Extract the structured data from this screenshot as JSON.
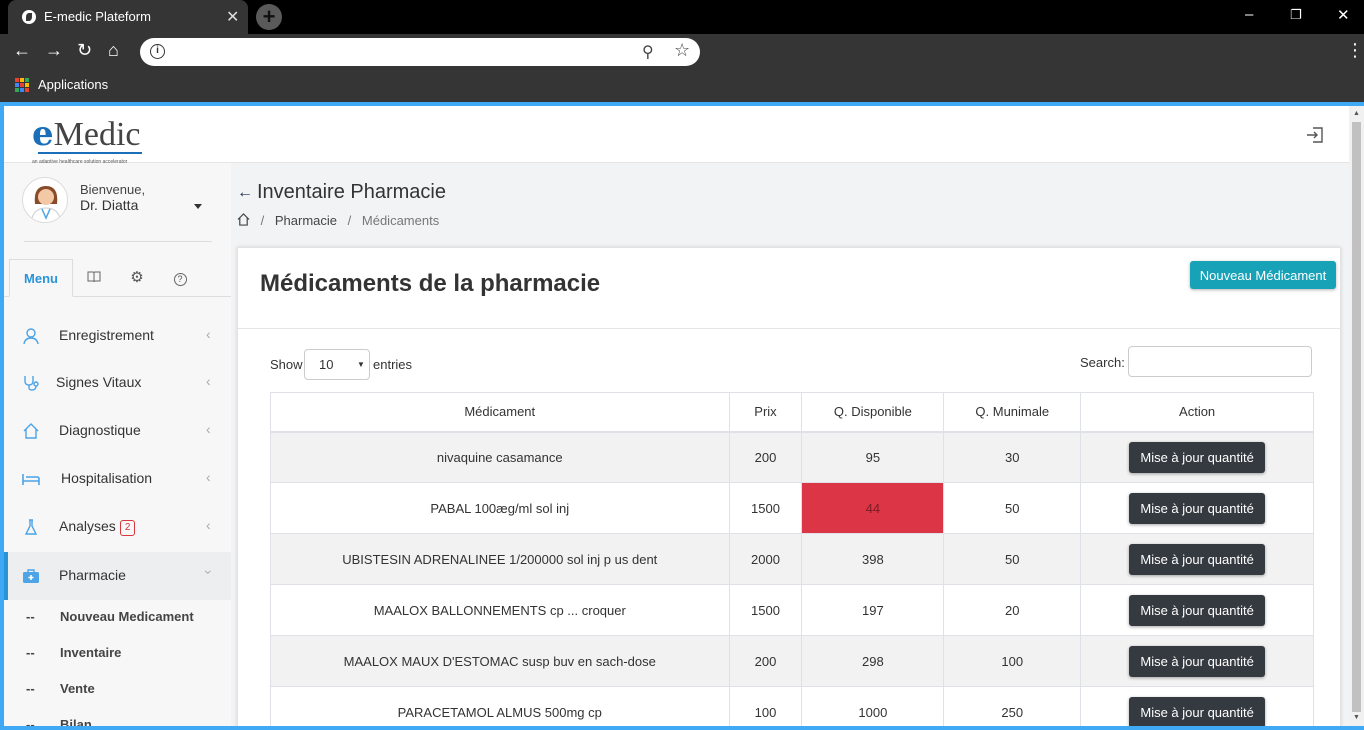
{
  "browser": {
    "tab_title": "E-medic Plateform",
    "tab_close": "✕",
    "new_tab": "+",
    "bookmark_apps": "Applications",
    "url": ""
  },
  "app": {
    "logo_e": "e",
    "logo_medic": "Medic",
    "logo_tagline": "an adaptive healthcare solution accelerator",
    "accent_color": "#2795d8",
    "danger_color": "#dc3545",
    "info_color": "#17a2b8"
  },
  "user": {
    "welcome": "Bienvenue,",
    "name": "Dr. Diatta"
  },
  "sidebar": {
    "tabs": [
      {
        "label": "Menu",
        "icon": ""
      },
      {
        "label": "",
        "icon": "book-icon"
      },
      {
        "label": "",
        "icon": "gear-icon"
      },
      {
        "label": "",
        "icon": "help-icon"
      }
    ],
    "items": [
      {
        "label": "Enregistrement",
        "icon": "user-icon"
      },
      {
        "label": "Signes Vitaux",
        "icon": "stethoscope-icon"
      },
      {
        "label": "Diagnostique",
        "icon": "home-icon"
      },
      {
        "label": "Hospitalisation",
        "icon": "bed-icon"
      },
      {
        "label": "Analyses",
        "icon": "flask-icon",
        "badge": "2"
      },
      {
        "label": "Pharmacie",
        "icon": "medkit-icon"
      }
    ],
    "subitems": [
      {
        "dash": "--",
        "label": "Nouveau Medicament"
      },
      {
        "dash": "--",
        "label": "Inventaire"
      },
      {
        "dash": "--",
        "label": "Vente"
      },
      {
        "dash": "--",
        "label": "Bilan"
      }
    ]
  },
  "page": {
    "title": "Inventaire Pharmacie",
    "breadcrumb": [
      "Pharmacie",
      "Médicaments"
    ]
  },
  "card": {
    "title": "Médicaments de la pharmacie",
    "new_button": "Nouveau Médicament",
    "show_label": "Show",
    "entries_label": "entries",
    "page_length": "10",
    "search_label": "Search:",
    "search_value": ""
  },
  "table": {
    "headers": [
      "Médicament",
      "Prix",
      "Q. Disponible",
      "Q. Munimale",
      "Action"
    ],
    "action_label": "Mise à jour quantité",
    "rows": [
      {
        "name": "nivaquine casamance",
        "prix": "200",
        "dispo": "95",
        "min": "30",
        "low": false
      },
      {
        "name": "PABAL 100æg/ml sol inj",
        "prix": "1500",
        "dispo": "44",
        "min": "50",
        "low": true
      },
      {
        "name": "UBISTESIN ADRENALINEE 1/200000 sol inj p us dent",
        "prix": "2000",
        "dispo": "398",
        "min": "50",
        "low": false
      },
      {
        "name": "MAALOX BALLONNEMENTS cp ... croquer",
        "prix": "1500",
        "dispo": "197",
        "min": "20",
        "low": false
      },
      {
        "name": "MAALOX MAUX D'ESTOMAC susp buv en sach-dose",
        "prix": "200",
        "dispo": "298",
        "min": "100",
        "low": false
      },
      {
        "name": "PARACETAMOL ALMUS 500mg cp",
        "prix": "100",
        "dispo": "1000",
        "min": "250",
        "low": false
      }
    ]
  }
}
